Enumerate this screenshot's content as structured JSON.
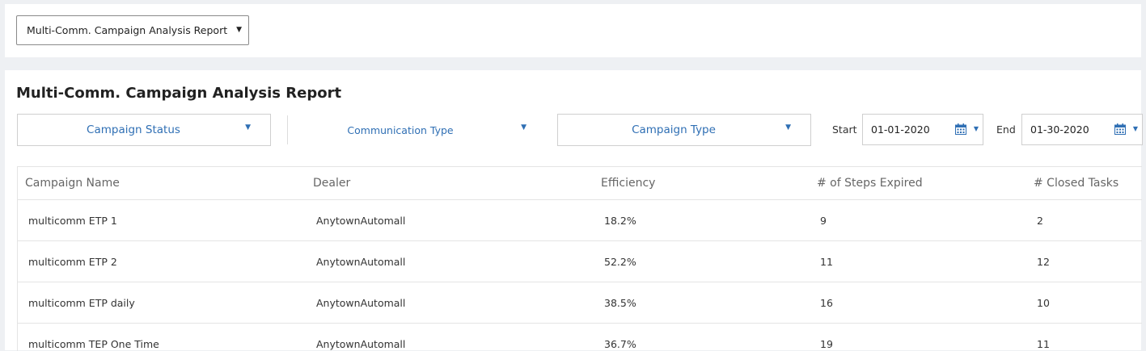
{
  "report_selector": {
    "selected": "Multi-Comm. Campaign Analysis Report"
  },
  "page": {
    "title": "Multi-Comm. Campaign Analysis Report"
  },
  "filters": {
    "campaign_status": "Campaign Status",
    "communication_type": "Communication Type",
    "campaign_type": "Campaign Type",
    "start_label": "Start",
    "start_date": "01-01-2020",
    "end_label": "End",
    "end_date": "01-30-2020"
  },
  "table": {
    "columns": [
      "Campaign Name",
      "Dealer",
      "Efficiency",
      "# of Steps Expired",
      "# Closed Tasks"
    ],
    "rows": [
      [
        "multicomm ETP 1",
        "AnytownAutomall",
        "18.2%",
        "9",
        "2"
      ],
      [
        "multicomm ETP 2",
        "AnytownAutomall",
        "52.2%",
        "11",
        "12"
      ],
      [
        "multicomm ETP daily",
        "AnytownAutomall",
        "38.5%",
        "16",
        "10"
      ],
      [
        "multicomm TEP One Time",
        "AnytownAutomall",
        "36.7%",
        "19",
        "11"
      ]
    ]
  },
  "colors": {
    "accent": "#2f6fb4",
    "background": "#eef0f3"
  },
  "icons": {
    "dropdown": "caret-down-icon",
    "calendar": "calendar-icon"
  }
}
